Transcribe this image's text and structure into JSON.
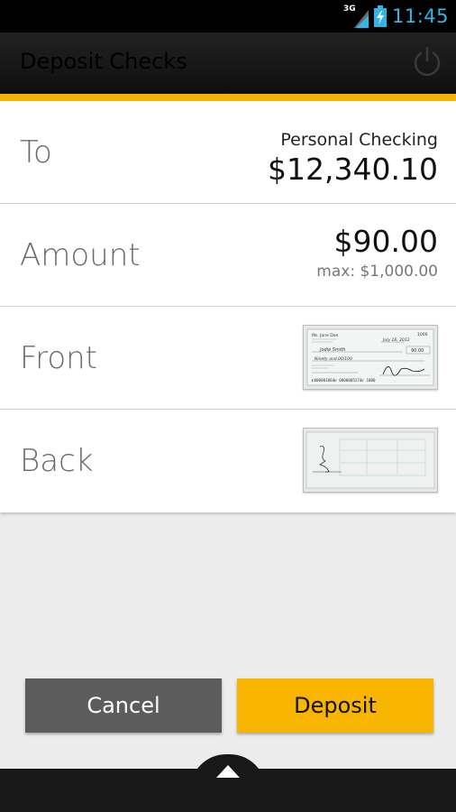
{
  "status_bar": {
    "network": "3G",
    "time": "11:45"
  },
  "action_bar": {
    "title": "Deposit Checks",
    "power_icon": "power-icon"
  },
  "colors": {
    "accent": "#f7b500",
    "status_clock": "#33b5e5",
    "cancel": "#5c5c5c"
  },
  "rows": {
    "to": {
      "label": "To",
      "account_name": "Personal Checking",
      "balance": "$12,340.10"
    },
    "amount": {
      "label": "Amount",
      "value": "$90.00",
      "max": "max: $1,000.00"
    },
    "front": {
      "label": "Front",
      "thumb_icon": "check-front-thumbnail"
    },
    "back": {
      "label": "Back",
      "thumb_icon": "check-back-thumbnail"
    }
  },
  "check_front": {
    "payer": "Ms. Jane Doe",
    "date": "July 16, 2012",
    "check_no": "1000",
    "payee": "Jodie Smith",
    "amount": "90.00",
    "written_amount": "Ninety and 00/100",
    "micr": "⑆000001864⑆ 0000005274⑈ 1000"
  },
  "buttons": {
    "cancel": "Cancel",
    "deposit": "Deposit"
  },
  "bottom": {
    "handle_icon": "chevron-up-icon"
  }
}
